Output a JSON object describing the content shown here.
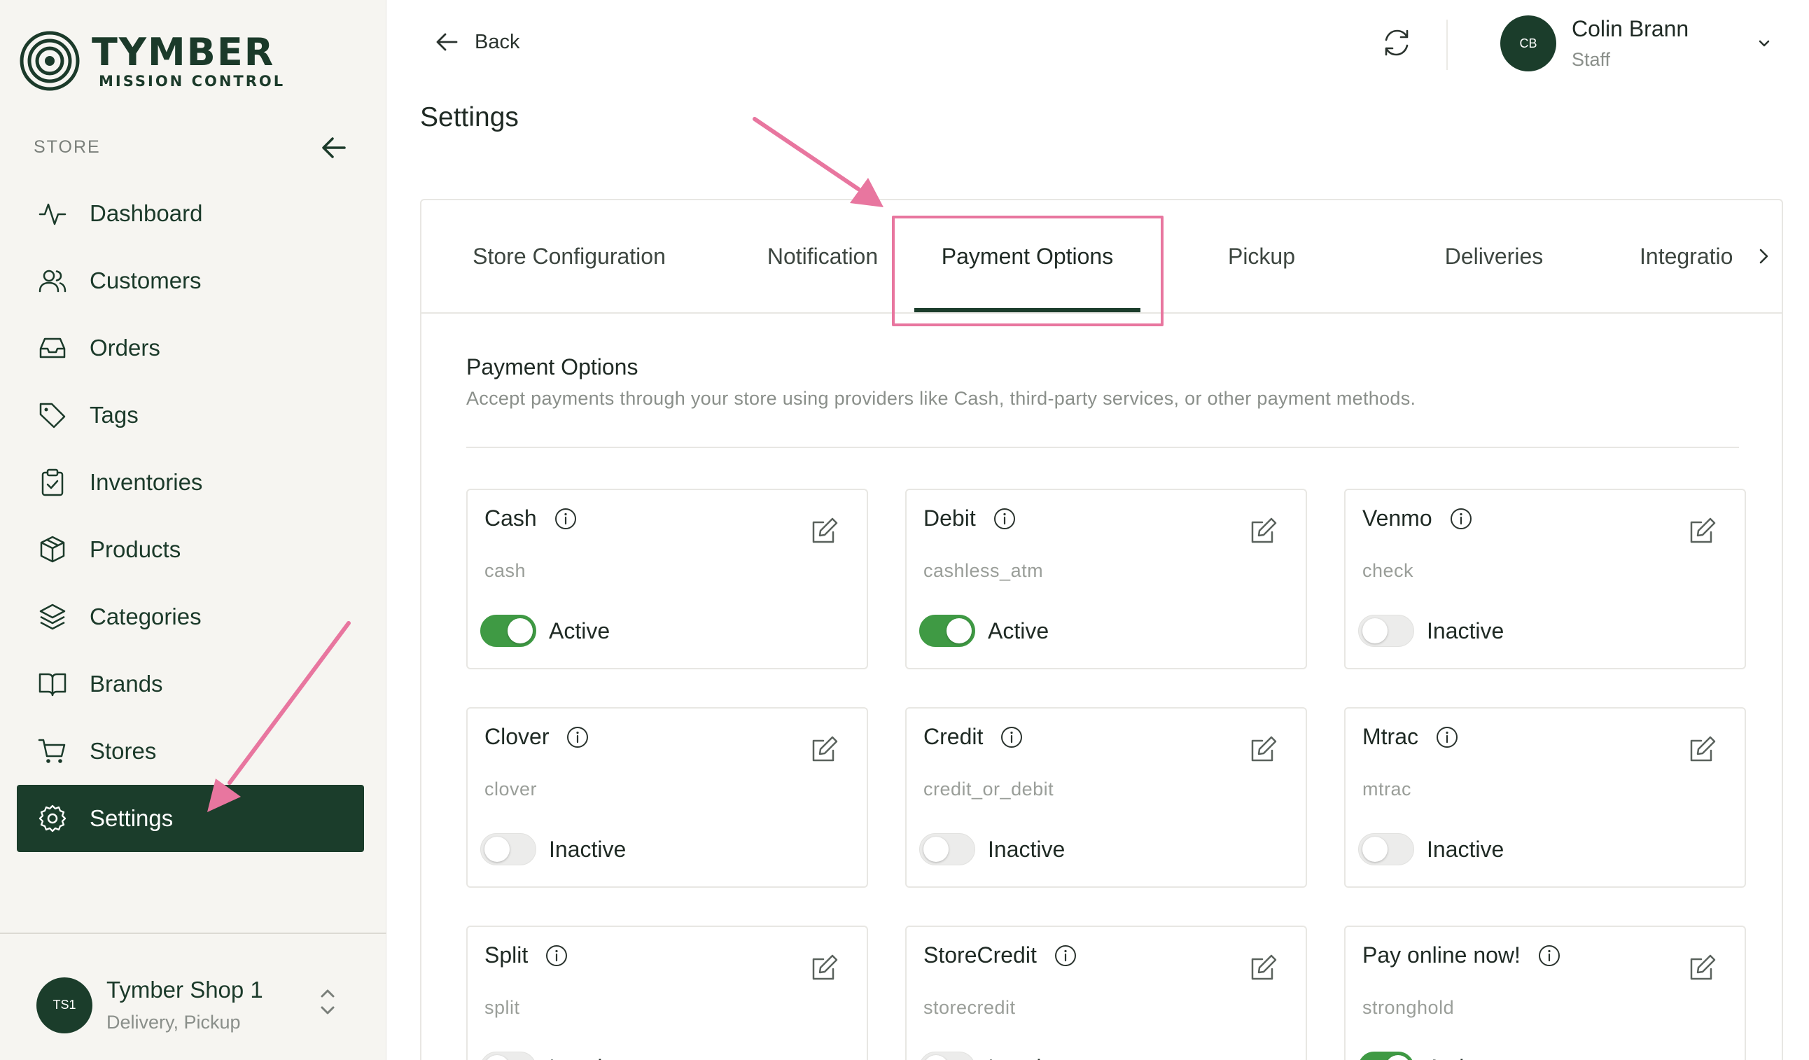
{
  "brand": {
    "name": "TYMBER",
    "subtitle": "MISSION CONTROL"
  },
  "sidebar": {
    "section_label": "STORE",
    "items": [
      {
        "label": "Dashboard",
        "icon": "activity-icon"
      },
      {
        "label": "Customers",
        "icon": "users-icon"
      },
      {
        "label": "Orders",
        "icon": "inbox-icon"
      },
      {
        "label": "Tags",
        "icon": "tag-icon"
      },
      {
        "label": "Inventories",
        "icon": "clipboard-check-icon"
      },
      {
        "label": "Products",
        "icon": "package-icon"
      },
      {
        "label": "Categories",
        "icon": "layers-icon"
      },
      {
        "label": "Brands",
        "icon": "book-open-icon"
      },
      {
        "label": "Stores",
        "icon": "shopping-cart-icon"
      },
      {
        "label": "Settings",
        "icon": "gear-icon",
        "active": true
      }
    ],
    "store": {
      "initials": "TS1",
      "name": "Tymber Shop 1",
      "subtitle": "Delivery, Pickup"
    }
  },
  "header": {
    "back_label": "Back",
    "page_title": "Settings",
    "user": {
      "initials": "CB",
      "name": "Colin Brann",
      "role": "Staff"
    }
  },
  "tabs": [
    {
      "label": "Store Configuration"
    },
    {
      "label": "Notification"
    },
    {
      "label": "Payment Options",
      "active": true
    },
    {
      "label": "Pickup"
    },
    {
      "label": "Deliveries"
    },
    {
      "label": "Integratio"
    }
  ],
  "payment_section": {
    "title": "Payment Options",
    "description": "Accept payments through your store using providers like Cash, third-party services, or other payment methods."
  },
  "payment_options": [
    {
      "name": "Cash",
      "code": "cash",
      "active": true,
      "status": "Active"
    },
    {
      "name": "Debit",
      "code": "cashless_atm",
      "active": true,
      "status": "Active"
    },
    {
      "name": "Venmo",
      "code": "check",
      "active": false,
      "status": "Inactive"
    },
    {
      "name": "Clover",
      "code": "clover",
      "active": false,
      "status": "Inactive"
    },
    {
      "name": "Credit",
      "code": "credit_or_debit",
      "active": false,
      "status": "Inactive"
    },
    {
      "name": "Mtrac",
      "code": "mtrac",
      "active": false,
      "status": "Inactive"
    },
    {
      "name": "Split",
      "code": "split",
      "active": false,
      "status": "Inactive"
    },
    {
      "name": "StoreCredit",
      "code": "storecredit",
      "active": false,
      "status": "Inactive"
    },
    {
      "name": "Pay online now!",
      "code": "stronghold",
      "active": true,
      "status": "Active"
    }
  ],
  "colors": {
    "brand_dark_green": "#1b3d2b",
    "toggle_active": "#3f9a44",
    "annotation_pink": "#e8769f",
    "sidebar_bg": "#f6f5f1"
  }
}
